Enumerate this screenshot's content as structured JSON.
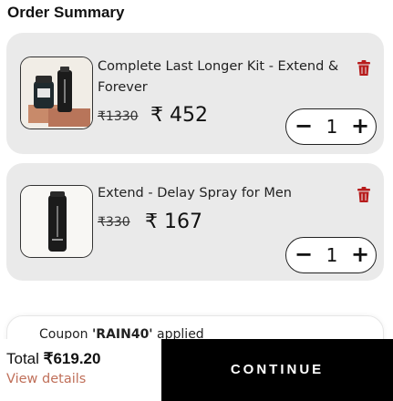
{
  "page": {
    "title": "Order Summary"
  },
  "items": [
    {
      "name": "Complete Last Longer Kit - Extend & Forever",
      "old_price": "₹1330",
      "price": "₹ 452",
      "quantity": "1",
      "image_icon": "product-kit-image"
    },
    {
      "name": "Extend - Delay Spray for Men",
      "old_price": "₹330",
      "price": "₹ 167",
      "quantity": "1",
      "image_icon": "spray-bottle-image"
    }
  ],
  "stepper": {
    "minus": "−",
    "plus": "+"
  },
  "coupon": {
    "prefix": "Coupon ",
    "code": "'RAIN40'",
    "suffix": " applied"
  },
  "footer": {
    "total_label": "Total ",
    "total_amount": "₹619.20",
    "view_details": "View details",
    "continue": "CONTINUE"
  },
  "colors": {
    "accent": "#c0705a",
    "delete": "#b71c1c",
    "card_bg": "#eaeaea",
    "cta_bg": "#000000"
  }
}
